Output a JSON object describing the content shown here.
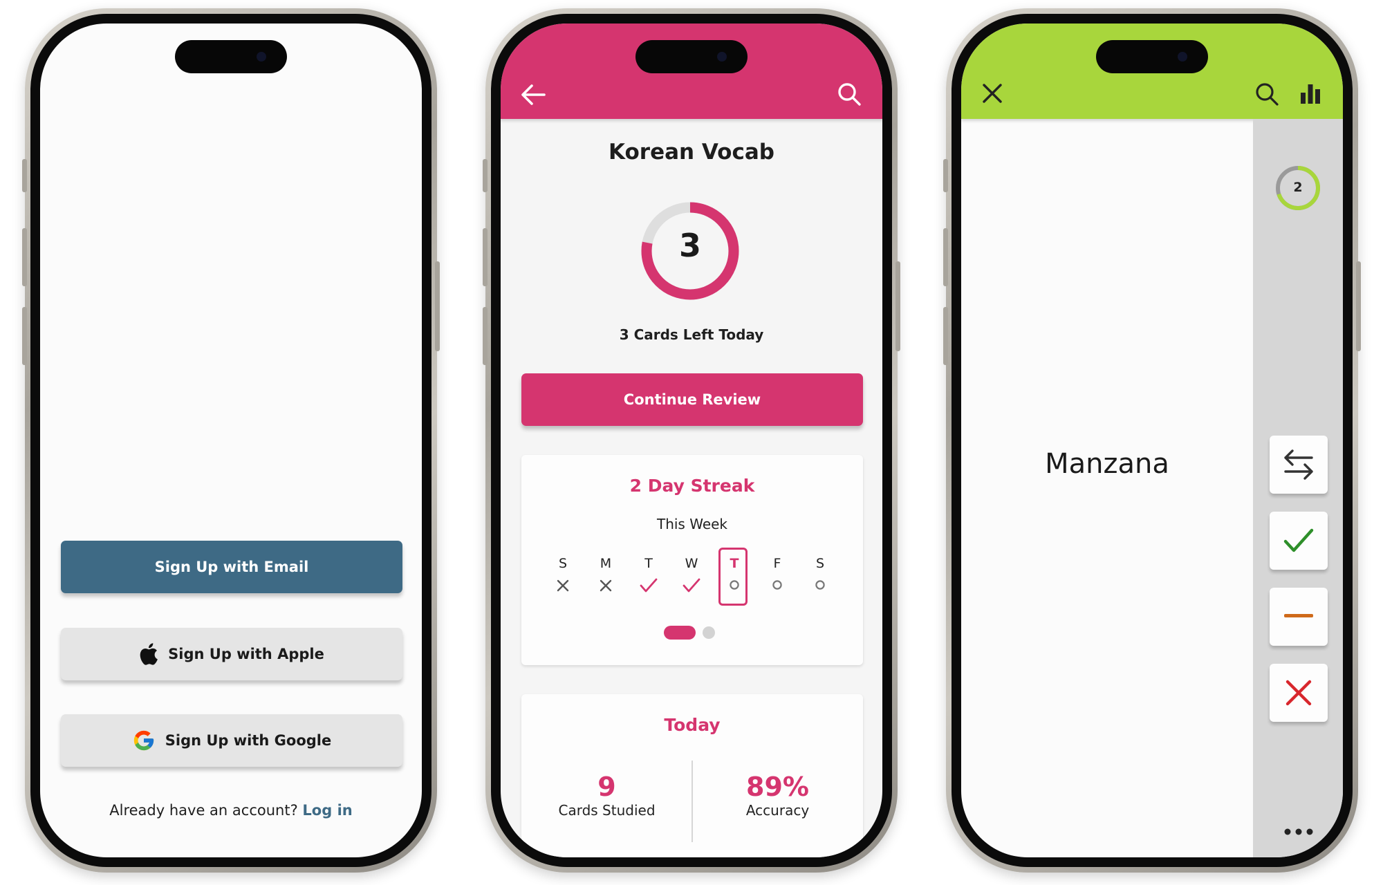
{
  "signup": {
    "email_label": "Sign Up with Email",
    "apple_label": "Sign Up with Apple",
    "google_label": "Sign Up with Google",
    "account_prompt": "Already have an account?",
    "login_link": "Log in",
    "colors": {
      "email_button": "#3e6a85",
      "secondary_button": "#e5e5e5",
      "login_link": "#3e6a85"
    }
  },
  "deck": {
    "header_color": "#d5356f",
    "title": "Korean Vocab",
    "cards_left_count": "3",
    "cards_left_progress": 0.78,
    "cards_left_label": "3 Cards Left Today",
    "continue_label": "Continue Review",
    "streak": {
      "title": "2 Day Streak",
      "subtitle": "This Week",
      "days": [
        {
          "letter": "S",
          "status": "missed"
        },
        {
          "letter": "M",
          "status": "missed"
        },
        {
          "letter": "T",
          "status": "done"
        },
        {
          "letter": "W",
          "status": "done"
        },
        {
          "letter": "T",
          "status": "today"
        },
        {
          "letter": "F",
          "status": "upcoming"
        },
        {
          "letter": "S",
          "status": "upcoming"
        }
      ]
    },
    "today": {
      "title": "Today",
      "cards_studied_value": "9",
      "cards_studied_label": "Cards Studied",
      "accuracy_value": "89%",
      "accuracy_label": "Accuracy"
    }
  },
  "review": {
    "header_color": "#a8d63c",
    "word": "Manzana",
    "remaining_count": "2",
    "remaining_progress": 0.7,
    "actions": [
      "swap-arrows-icon",
      "check-icon",
      "minus-icon",
      "x-icon"
    ],
    "colors": {
      "check": "#2e8f2a",
      "minus": "#cf6a1a",
      "x": "#d8262c"
    }
  }
}
